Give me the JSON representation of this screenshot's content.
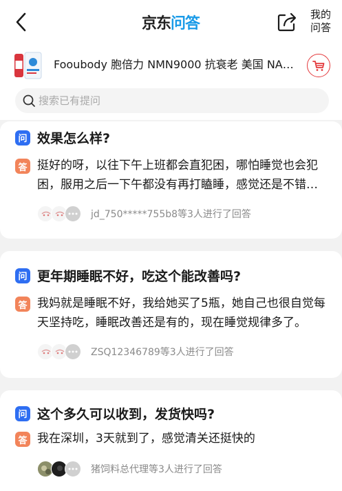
{
  "header": {
    "logo_jd": "京东",
    "logo_qa": "问答",
    "my_qa_line1": "我的",
    "my_qa_line2": "问答"
  },
  "product": {
    "title": "Fooubody 胞倍力 NMN9000 抗衰老 美国 NAD..."
  },
  "search": {
    "placeholder": "搜索已有提问"
  },
  "badges": {
    "question": "问",
    "answer": "答"
  },
  "questions": [
    {
      "question": "效果怎么样?",
      "answer": "挺好的呀，以往下午上班都会直犯困，哪怕睡觉也会犯困，服用之后一下午都没有再打瞌睡，感觉还是不错的。",
      "answerers_text": "jd_750*****755b8等3人进行了回答"
    },
    {
      "question": "更年期睡眠不好，吃这个能改善吗?",
      "answer": "我妈就是睡眠不好，我给她买了5瓶，她自己也很自觉每天坚持吃，睡眠改善还是有的，现在睡觉规律多了。",
      "answerers_text": "ZSQ12346789等3人进行了回答"
    },
    {
      "question": "这个多久可以收到，发货快吗?",
      "answer": "我在深圳，3天就到了，感觉清关还挺快的",
      "answerers_text": "猪饲料总代理等3人进行了回答"
    }
  ],
  "colors": {
    "question_badge": "#2e6ef2",
    "answer_badge": "#f2845a",
    "brand_red": "#e4393c",
    "logo_blue": "#1a9be8"
  }
}
